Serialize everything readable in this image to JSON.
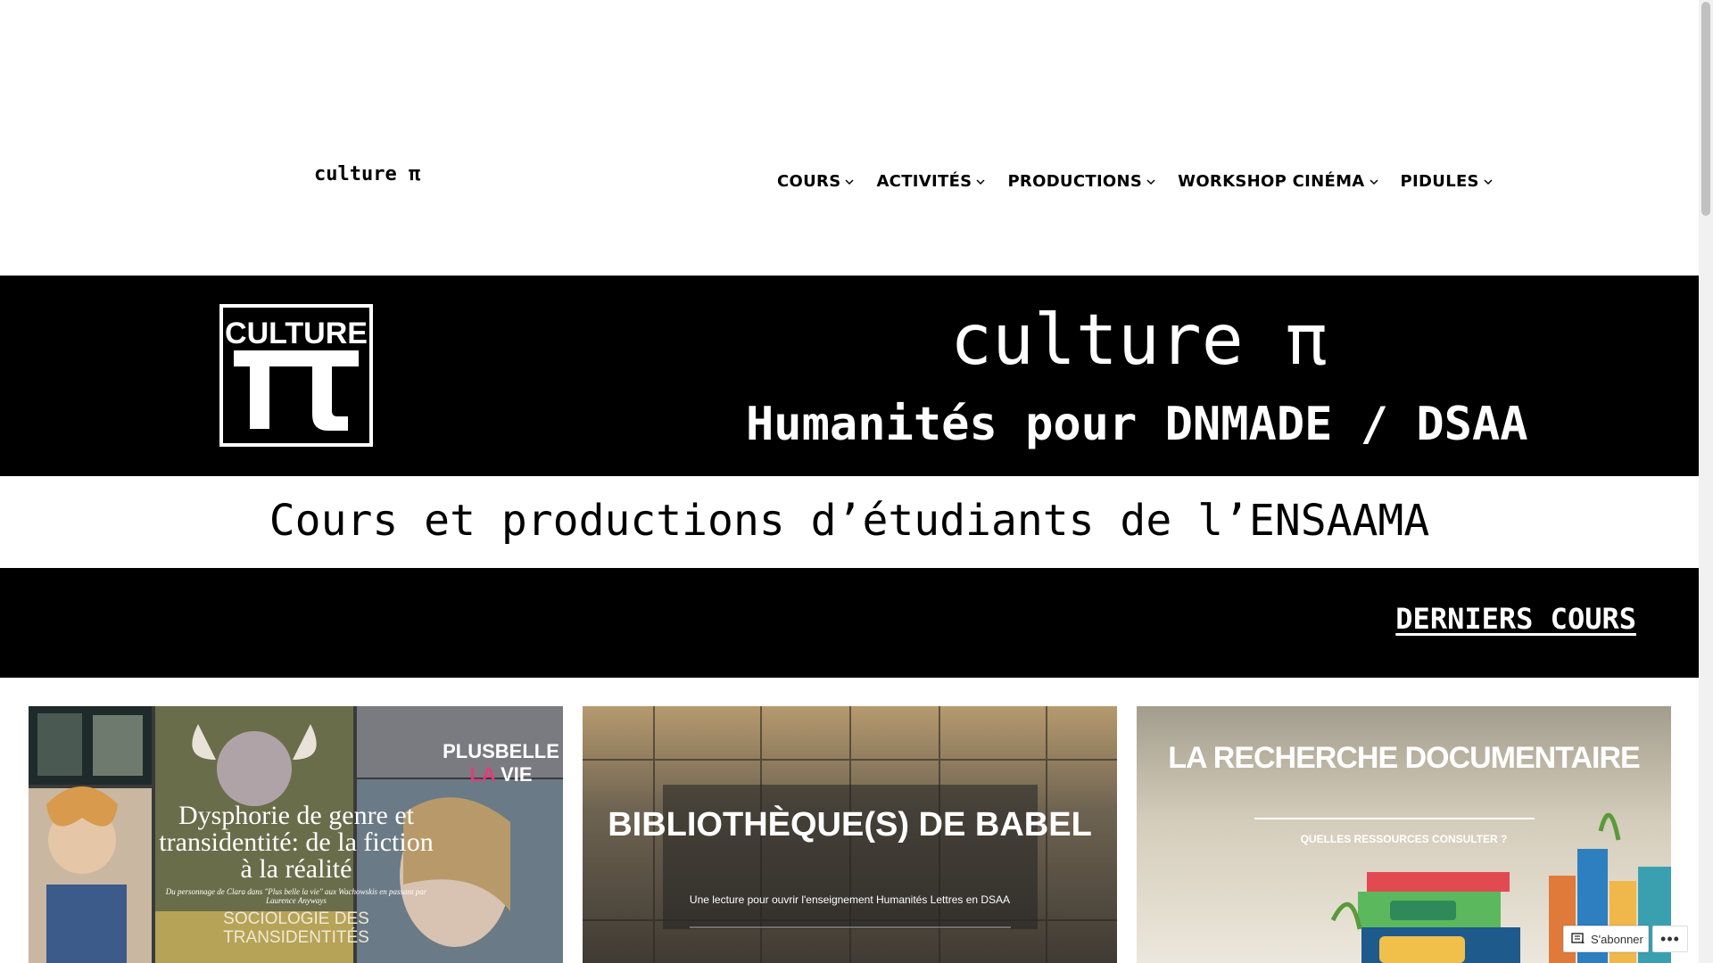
{
  "header": {
    "site_title": "culture π",
    "nav": [
      {
        "label": "COURS"
      },
      {
        "label": "ACTIVITÉS"
      },
      {
        "label": "PRODUCTIONS"
      },
      {
        "label": "WORKSHOP CINÉMA"
      },
      {
        "label": "PIDULES"
      }
    ]
  },
  "hero": {
    "logo_word": "CULTURE",
    "title": "culture π",
    "subtitle": "Humanités pour DNMADE / DSAA"
  },
  "tagline": "Cours et productions d’étudiants de l’ENSAAMA",
  "latest": {
    "link_label": "DERNIERS COURS"
  },
  "cards": [
    {
      "title": "Dysphorie de genre et transidentité: de la fiction à la réalité",
      "subtitle": "Du personnage de Clara dans \"Plus belle la vie\" aux Wachowskis en passant par Laurence Anyways",
      "section": "SOCIOLOGIE DES TRANSIDENTITÉS",
      "overlay_word_a": "PLUSBELLE",
      "overlay_word_b": "LA",
      "overlay_word_c": "VIE"
    },
    {
      "title": "BIBLIOTHÈQUE(S) DE BABEL",
      "subtitle": "Une lecture pour ouvrir l'enseignement Humanités Lettres en DSAA"
    },
    {
      "title": "LA RECHERCHE DOCUMENTAIRE",
      "subtitle": "QUELLES RESSOURCES CONSULTER ?"
    }
  ],
  "subscribe": {
    "label": "S'abonner",
    "more": "•••"
  },
  "colors": {
    "hero_bg": "#000000",
    "accent_pink": "#e13c7a"
  }
}
